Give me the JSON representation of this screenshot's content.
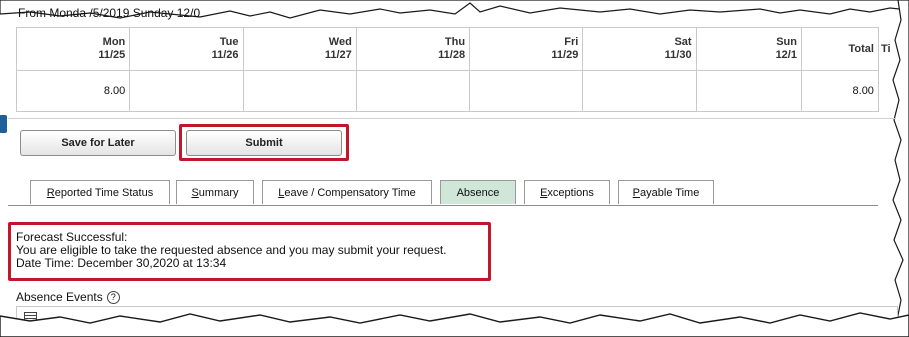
{
  "header": {
    "period_text": "From Monda   /5/2019  Sunday 12/0"
  },
  "timesheet": {
    "days": [
      {
        "day": "Mon",
        "date": "11/25"
      },
      {
        "day": "Tue",
        "date": "11/26"
      },
      {
        "day": "Wed",
        "date": "11/27"
      },
      {
        "day": "Thu",
        "date": "11/28"
      },
      {
        "day": "Fri",
        "date": "11/29"
      },
      {
        "day": "Sat",
        "date": "11/30"
      },
      {
        "day": "Sun",
        "date": "12/1"
      }
    ],
    "total_label": "Total",
    "extra_col_label": "Ti",
    "values": [
      "8.00",
      "",
      "",
      "",
      "",
      "",
      ""
    ],
    "total_value": "8.00"
  },
  "actions": {
    "save_for_later": "Save for Later",
    "submit": "Submit"
  },
  "tabs": [
    {
      "label": "Reported Time Status",
      "underline": "R",
      "rest": "eported Time Status",
      "active": false
    },
    {
      "label": "Summary",
      "underline": "S",
      "rest": "ummary",
      "active": false
    },
    {
      "label": "Leave / Compensatory Time",
      "underline": "L",
      "rest": "eave / Compensatory Time",
      "active": false
    },
    {
      "label": "Absence",
      "underline": "",
      "rest": "Absence",
      "active": true
    },
    {
      "label": "Exceptions",
      "underline": "E",
      "rest": "xceptions",
      "active": false
    },
    {
      "label": "Payable Time",
      "underline": "P",
      "rest": "ayable Time",
      "active": false
    }
  ],
  "message": {
    "line1": "Forecast Successful:",
    "line2": "You are eligible to take the requested absence and you may submit your request.",
    "line3": "Date Time: December 30,2020 at 13:34"
  },
  "absence_events": {
    "title": "Absence Events",
    "help_icon": "?"
  },
  "colors": {
    "highlight": "#c0182b",
    "active_tab": "#cfe6d8",
    "left_tab": "#1f5f9a"
  }
}
